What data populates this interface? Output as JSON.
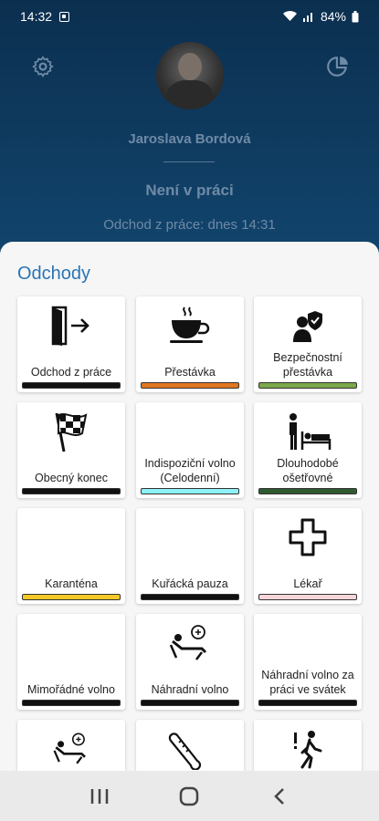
{
  "status_bar": {
    "time": "14:32",
    "battery": "84%"
  },
  "profile": {
    "name": "Jaroslava Bordová",
    "status": "Není v práci",
    "last_event": "Odchod z práce: dnes 14:31"
  },
  "section_title": "Odchody",
  "tiles": [
    {
      "label": "Odchod z práce",
      "icon": "exit-door-icon",
      "color": "#111111"
    },
    {
      "label": "Přestávka",
      "icon": "coffee-cup-icon",
      "color": "#e0761f"
    },
    {
      "label": "Bezpečnostní přestávka",
      "icon": "worker-shield-icon",
      "color": "#7aa84a"
    },
    {
      "label": "Obecný konec",
      "icon": "checkered-flag-icon",
      "color": "#111111"
    },
    {
      "label": "Indispoziční volno (Celodenní)",
      "icon": "",
      "color": "#8ef2f6"
    },
    {
      "label": "Dlouhodobé ošetřovné",
      "icon": "caregiver-bed-icon",
      "color": "#2f5a30"
    },
    {
      "label": "Karanténa",
      "icon": "",
      "color": "#f5c928"
    },
    {
      "label": "Kuřácká pauza",
      "icon": "",
      "color": "#111111"
    },
    {
      "label": "Lékař",
      "icon": "medical-cross-icon",
      "color": "#f6d6da"
    },
    {
      "label": "Mimořádné volno",
      "icon": "",
      "color": "#111111"
    },
    {
      "label": "Náhradní volno",
      "icon": "lounge-chair-icon",
      "color": "#111111"
    },
    {
      "label": "Náhradní volno za práci ve svátek",
      "icon": "",
      "color": "#111111"
    },
    {
      "label": "",
      "icon": "lounge-chair-icon",
      "color": ""
    },
    {
      "label": "",
      "icon": "thermometer-icon",
      "color": ""
    },
    {
      "label": "",
      "icon": "walking-person-icon",
      "color": ""
    }
  ]
}
